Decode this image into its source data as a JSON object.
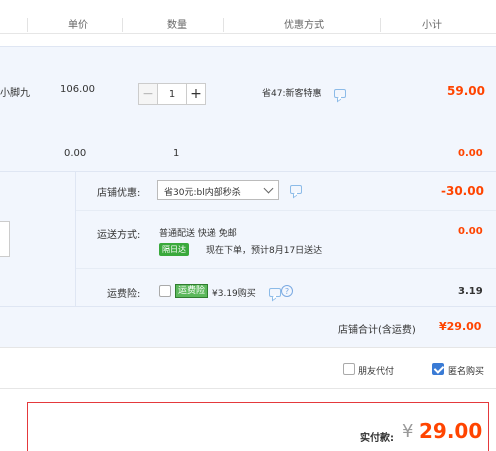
{
  "table_header": {
    "unit_price": "单价",
    "quantity": "数量",
    "discount": "优惠方式",
    "subtotal": "小计"
  },
  "item": {
    "name_fragment": "小脚九",
    "unit_price": "106.00",
    "quantity": "1",
    "discount_text": "省47:新客特惠",
    "subtotal": "59.00"
  },
  "extra_row": {
    "price": "0.00",
    "quantity": "1",
    "subtotal": "0.00"
  },
  "shop": {
    "coupon_label": "店铺优惠:",
    "coupon_selected": "省30元:bl内部秒杀",
    "coupon_amount": "-30.00",
    "shipping_label": "运送方式:",
    "shipping_method": "普通配送 快递 免邮",
    "delivery_badge": "隔日达",
    "delivery_text": "现在下单，预计8月17日送达",
    "shipping_amount": "0.00",
    "insurance_label": "运费险:",
    "insurance_badge": "运费险",
    "insurance_price": "¥3.19购买",
    "insurance_amount": "3.19",
    "total_label": "店铺合计(含运费)",
    "total_amount": "¥29.00"
  },
  "options": {
    "friend_pay": "朋友代付",
    "anonymous": "匿名购买",
    "friend_pay_checked": false,
    "anonymous_checked": true
  },
  "payment": {
    "label": "实付款:",
    "currency": "¥",
    "amount": "29.00"
  },
  "colors": {
    "accent_red": "#f40",
    "row_bg": "#f2f6fd",
    "checkbox_blue": "#3a7bd5",
    "badge_green": "#3aa93c"
  }
}
